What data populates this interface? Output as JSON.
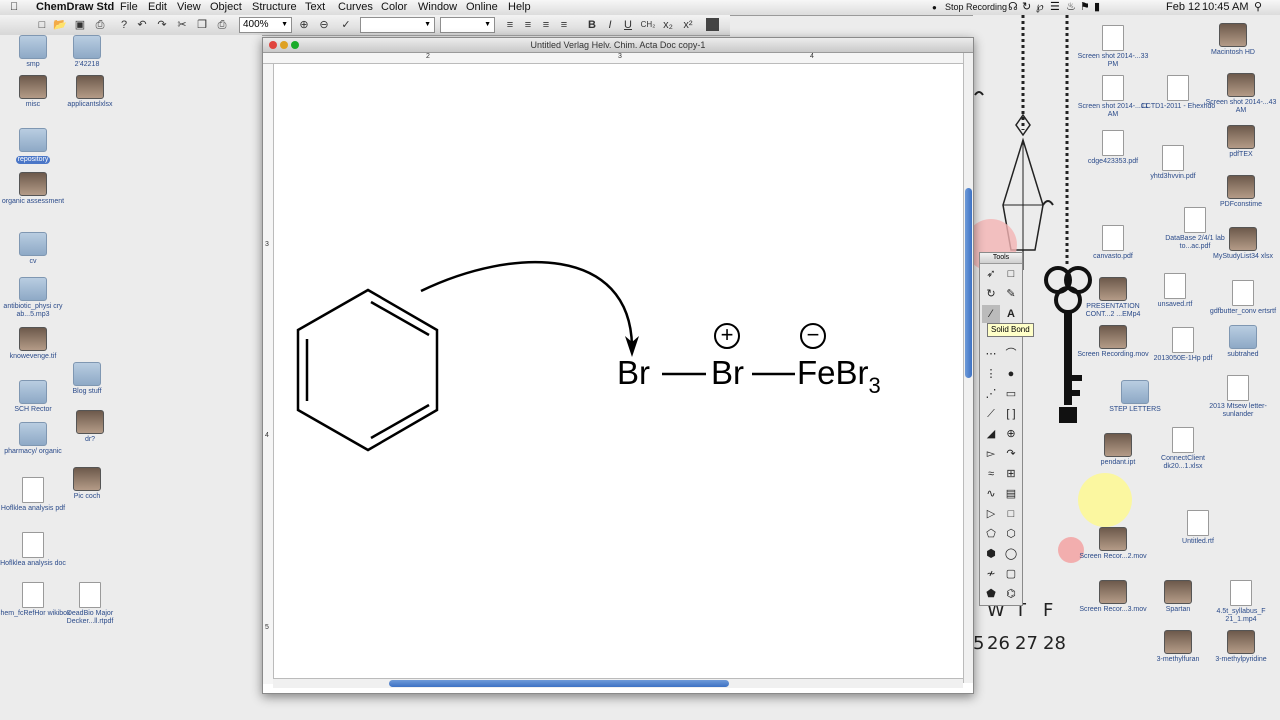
{
  "menubar": {
    "app_name": "ChemDraw Std",
    "menus": [
      "File",
      "Edit",
      "View",
      "Object",
      "Structure",
      "Text",
      "Curves",
      "Color",
      "Window",
      "Online",
      "Help"
    ],
    "stop_recording": "Stop Recording",
    "date": "Feb 12",
    "time": "10:45 AM"
  },
  "toolbar": {
    "zoom": "400%"
  },
  "document": {
    "title": "Untitled Verlag Helv. Chim. Acta Doc copy-1",
    "ruler_h": [
      "2",
      "3",
      "4"
    ],
    "ruler_v": [
      "3",
      "4",
      "5"
    ],
    "atoms": {
      "br1": "Br",
      "br2": "Br",
      "febr": "FeBr",
      "subscript": "3",
      "plus": "+",
      "minus": "−"
    }
  },
  "tools": {
    "title": "Tools",
    "tooltip": "Solid Bond"
  },
  "desktop_left": [
    {
      "label": "smp",
      "kind": "folder"
    },
    {
      "label": "2'42218",
      "kind": "folder"
    },
    {
      "label": "misc",
      "kind": "img"
    },
    {
      "label": "applicantslxlsx",
      "kind": "img"
    },
    {
      "label": "repository",
      "kind": "folder",
      "selected": true
    },
    {
      "label": "organic assessment",
      "kind": "img"
    },
    {
      "label": "cv",
      "kind": "folder"
    },
    {
      "label": "antibiotic_physi cry ab...5.mp3",
      "kind": "folder"
    },
    {
      "label": "knowevenge.tif",
      "kind": "img"
    },
    {
      "label": "Blog stuff",
      "kind": "folder"
    },
    {
      "label": "SCH Rector",
      "kind": "folder"
    },
    {
      "label": "dr?",
      "kind": "img"
    },
    {
      "label": "pharmacy/ organic",
      "kind": "folder"
    },
    {
      "label": "Pic coch",
      "kind": "img"
    },
    {
      "label": "Hoflklea analysis pdf",
      "kind": "doc"
    },
    {
      "label": "Hoflklea analysis doc",
      "kind": "doc"
    },
    {
      "label": "Chem_fcRefHor wikibox",
      "kind": "doc"
    },
    {
      "label": "DeadBio Major Decker...ll.rtpdf",
      "kind": "doc"
    }
  ],
  "desktop_right": [
    {
      "label": "Screen shot 2014-...33 PM",
      "kind": "doc"
    },
    {
      "label": "Macintosh HD",
      "kind": "img"
    },
    {
      "label": "Screen shot 2014-...11 AM",
      "kind": "doc"
    },
    {
      "label": "CCTD1-2011 - Ehexhdo",
      "kind": "doc"
    },
    {
      "label": "Screen shot 2014-...43 AM",
      "kind": "img"
    },
    {
      "label": "cdge423353.pdf",
      "kind": "doc"
    },
    {
      "label": "yhtd3hvvin.pdf",
      "kind": "doc"
    },
    {
      "label": "pdfTEX",
      "kind": "img"
    },
    {
      "label": "PDFconstime",
      "kind": "img"
    },
    {
      "label": "canvasto.pdf",
      "kind": "doc"
    },
    {
      "label": "DataBase 2/4/1 lab to...ac.pdf",
      "kind": "doc"
    },
    {
      "label": "MyStudyList34 xlsx",
      "kind": "img"
    },
    {
      "label": "PRESENTATION CONT...2 ...EMp4",
      "kind": "img"
    },
    {
      "label": "unsaved.rtf",
      "kind": "doc"
    },
    {
      "label": "gdfbutter_conv ertsrtf",
      "kind": "doc"
    },
    {
      "label": "Screen Recording.mov",
      "kind": "img"
    },
    {
      "label": "2013050E-1Hp pdf",
      "kind": "doc"
    },
    {
      "label": "subtrahed",
      "kind": "folder"
    },
    {
      "label": "STEP LETTERS",
      "kind": "folder"
    },
    {
      "label": "2013 Mtsew letter-sunlander",
      "kind": "doc"
    },
    {
      "label": "pendant.ipt",
      "kind": "img"
    },
    {
      "label": "ConnectClient dk20...1.xlsx",
      "kind": "doc"
    },
    {
      "label": "Screen Recor...2.mov",
      "kind": "img"
    },
    {
      "label": "Untitled.rtf",
      "kind": "doc"
    },
    {
      "label": "Screen Recor...3.mov",
      "kind": "img"
    },
    {
      "label": "Spartan",
      "kind": "img"
    },
    {
      "label": "4.5t_syllabus_F 21_1.mp4",
      "kind": "doc"
    },
    {
      "label": "3-methylfuran",
      "kind": "img"
    },
    {
      "label": "3-methylpyridine",
      "kind": "img"
    }
  ],
  "wallpaper_calendar": {
    "days": [
      "W",
      "T",
      "F"
    ],
    "dates": [
      "26",
      "27",
      "28"
    ],
    "partial": "5"
  }
}
